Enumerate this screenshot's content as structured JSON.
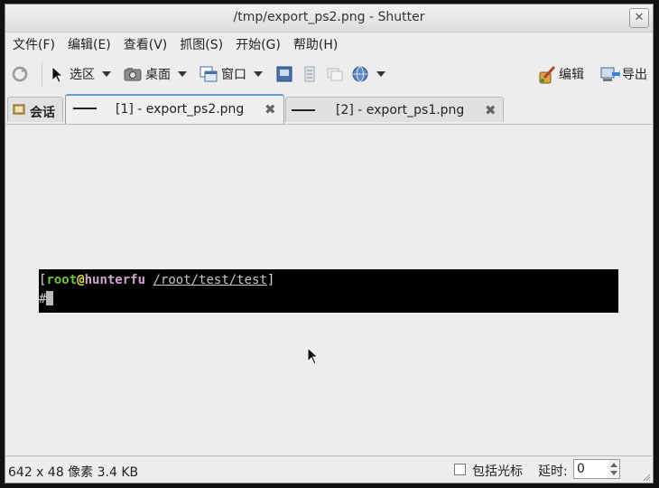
{
  "window": {
    "title": "/tmp/export_ps2.png - Shutter"
  },
  "menu": [
    "文件(F)",
    "编辑(E)",
    "查看(V)",
    "抓图(S)",
    "开始(G)",
    "帮助(H)"
  ],
  "toolbar": {
    "selection": "选区",
    "desktop": "桌面",
    "window": "窗口",
    "edit": "编辑",
    "export": "导出"
  },
  "tabs": {
    "session": "会话",
    "tab1": "[1] - export_ps2.png",
    "tab2": "[2] - export_ps1.png"
  },
  "terminal": {
    "bracket_open": "[",
    "user": "root",
    "at": "@",
    "host": "hunterfu",
    "path": "/root/test/test",
    "bracket_close": "]",
    "prompt": "#"
  },
  "status": {
    "info": "642 x 48 像素  3.4 KB",
    "include_cursor": "包括光标",
    "delay_label": "延时:",
    "delay_value": "0"
  },
  "colors": {
    "user": "#6fc33a",
    "at": "#e8e24a",
    "host": "#cfa4ce",
    "path": "#c8c8c8"
  }
}
